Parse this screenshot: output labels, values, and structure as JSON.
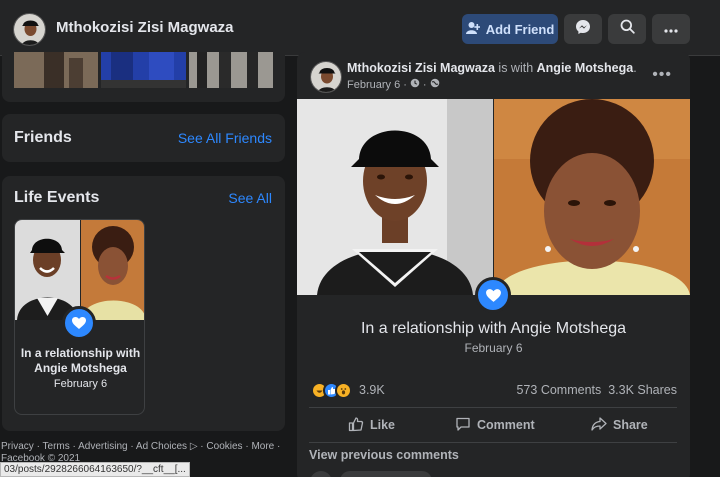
{
  "header": {
    "profile_name": "Mthokozisi Zisi Magwaza",
    "add_friend_label": "Add Friend",
    "icons": [
      "add-friend-icon",
      "messenger-icon",
      "search-icon",
      "more-icon"
    ],
    "accent": "#2d88ff"
  },
  "friends": {
    "title": "Friends",
    "link": "See All Friends"
  },
  "life_events": {
    "title": "Life Events",
    "link": "See All",
    "event": {
      "title": "In a relationship with Angie Motshega",
      "date": "February 6"
    }
  },
  "footer": {
    "links": [
      "Privacy",
      "Terms",
      "Advertising",
      "Ad Choices",
      "Cookies",
      "More"
    ],
    "copyright": "Facebook © 2021",
    "status_url": "03/posts/2928266064163650/?__cft__[..."
  },
  "post": {
    "author": "Mthokozisi Zisi Magwaza",
    "with_text": "is with",
    "tagged": "Angie Motshega",
    "date": "February 6",
    "event_title": "In a relationship with Angie Motshega",
    "event_date": "February 6",
    "reaction_count": "3.9K",
    "comments": "573 Comments",
    "shares": "3.3K Shares",
    "actions": {
      "like": "Like",
      "comment": "Comment",
      "share": "Share"
    },
    "view_previous": "View previous comments"
  }
}
